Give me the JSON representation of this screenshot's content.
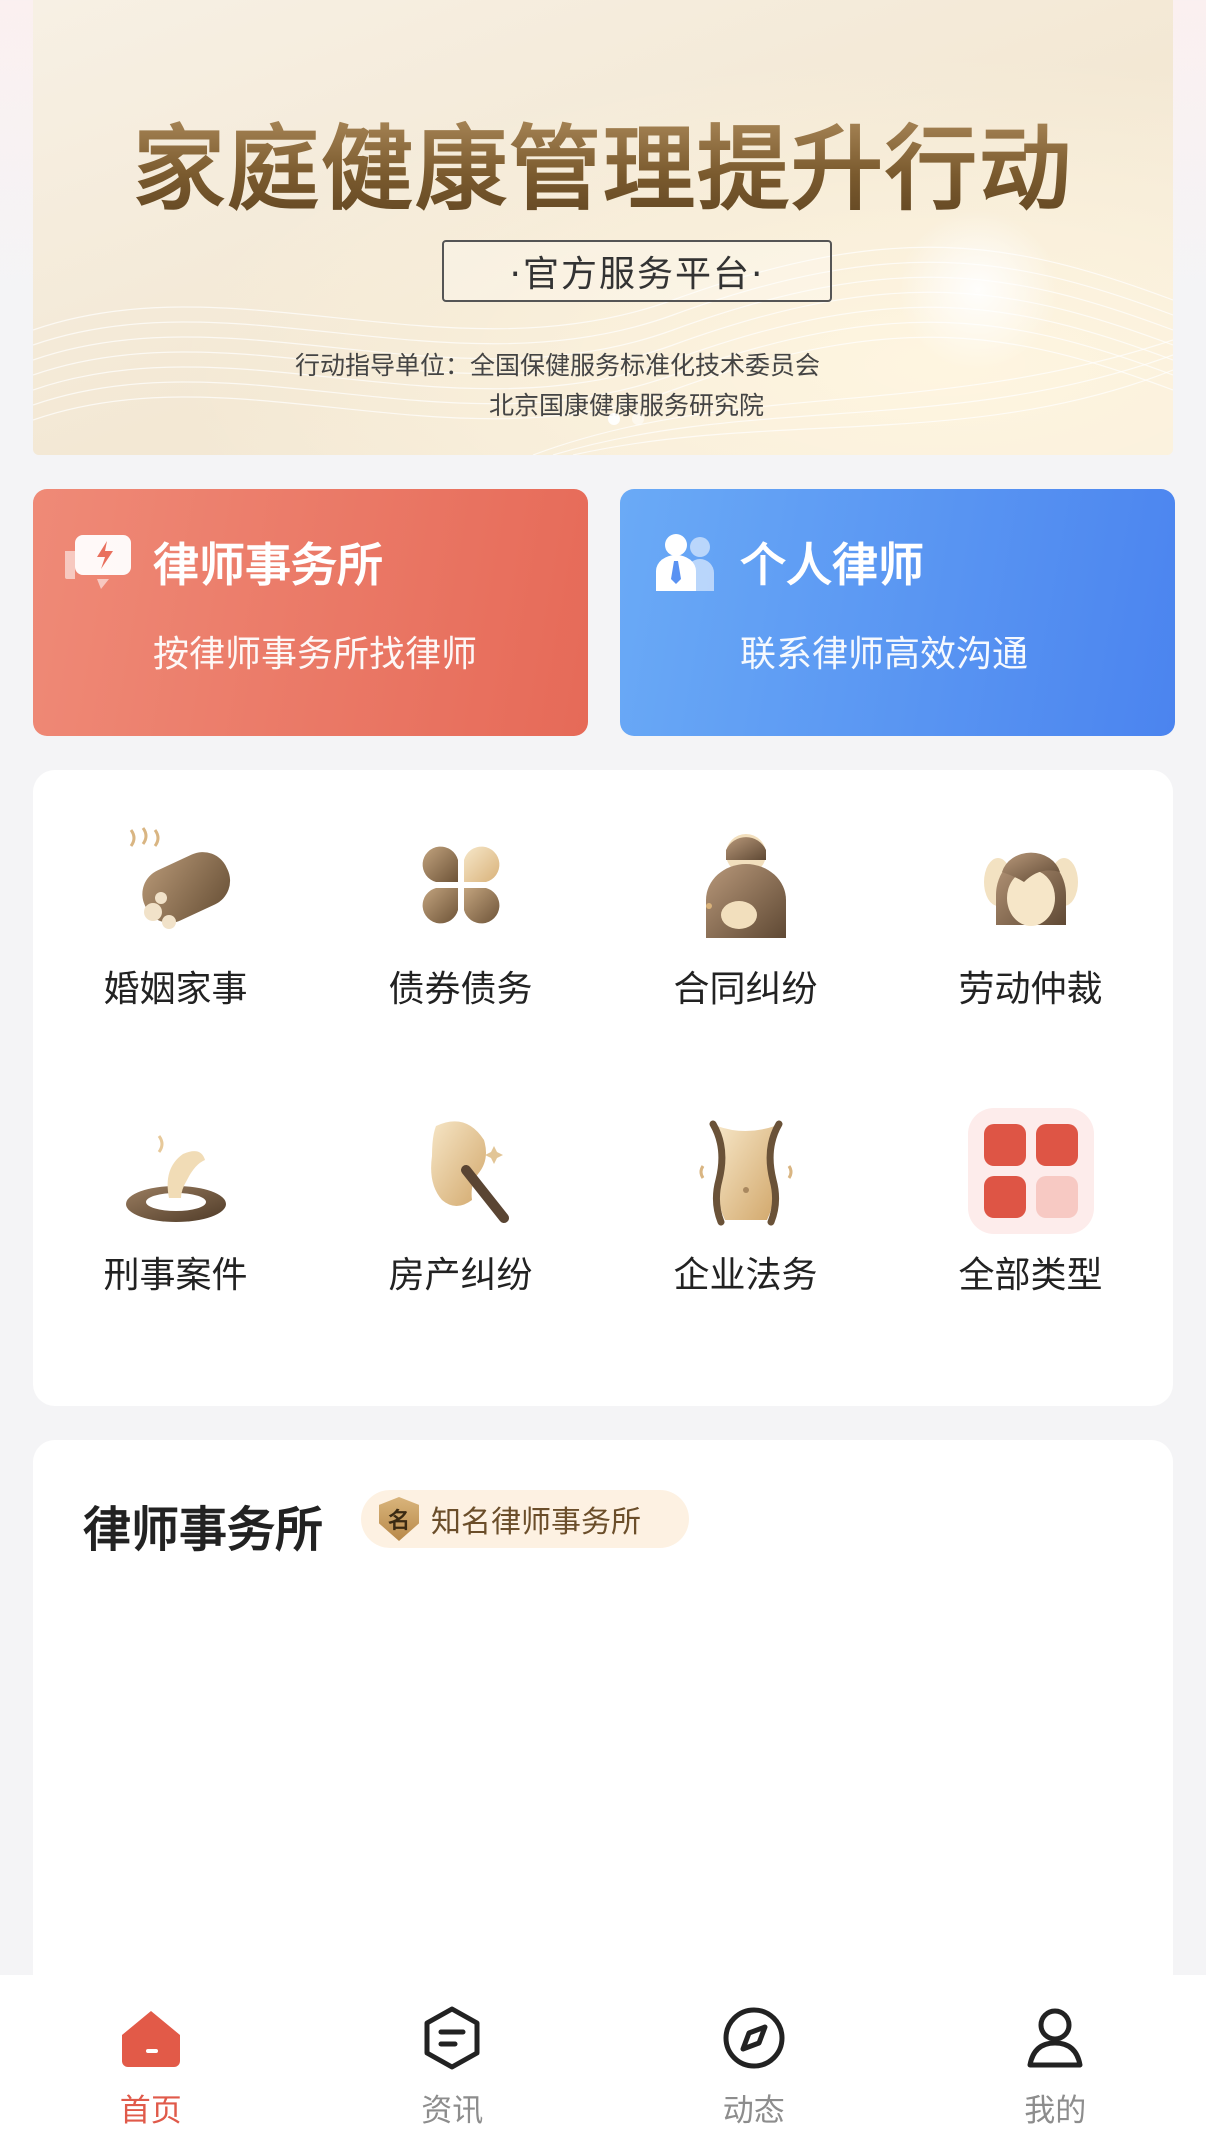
{
  "banner": {
    "title": "家庭健康管理提升行动",
    "badge": "·官方服务平台·",
    "guide_label_line1": "行动指导单位：全国保健服务标准化技术委员会",
    "guide_label_line2": "北京国康健康服务研究院",
    "slide_count": 2,
    "active_slide": 1
  },
  "quick_cards": [
    {
      "title": "律师事务所",
      "subtitle": "按律师事务所找律师",
      "icon": "chat-bubble-icon",
      "color": "#e96b59"
    },
    {
      "title": "个人律师",
      "subtitle": "联系律师高效沟通",
      "icon": "people-icon",
      "color": "#568ff1"
    }
  ],
  "categories": [
    {
      "label": "婚姻家事",
      "icon": "marriage-icon"
    },
    {
      "label": "债券债务",
      "icon": "debt-icon"
    },
    {
      "label": "合同纠纷",
      "icon": "contract-icon"
    },
    {
      "label": "劳动仲裁",
      "icon": "labor-icon"
    },
    {
      "label": "刑事案件",
      "icon": "criminal-icon"
    },
    {
      "label": "房产纠纷",
      "icon": "property-icon"
    },
    {
      "label": "企业法务",
      "icon": "enterprise-icon"
    },
    {
      "label": "全部类型",
      "icon": "all-types-icon"
    }
  ],
  "firm_section": {
    "title": "律师事务所",
    "tag": "知名律师事务所",
    "tag_badge": "名"
  },
  "tabbar": {
    "items": [
      {
        "label": "首页",
        "icon": "home-icon",
        "active": true
      },
      {
        "label": "资讯",
        "icon": "news-icon",
        "active": false
      },
      {
        "label": "动态",
        "icon": "compass-icon",
        "active": false
      },
      {
        "label": "我的",
        "icon": "user-icon",
        "active": false
      }
    ],
    "active_color": "#e05a4a",
    "inactive_color": "#8d8d8d"
  }
}
